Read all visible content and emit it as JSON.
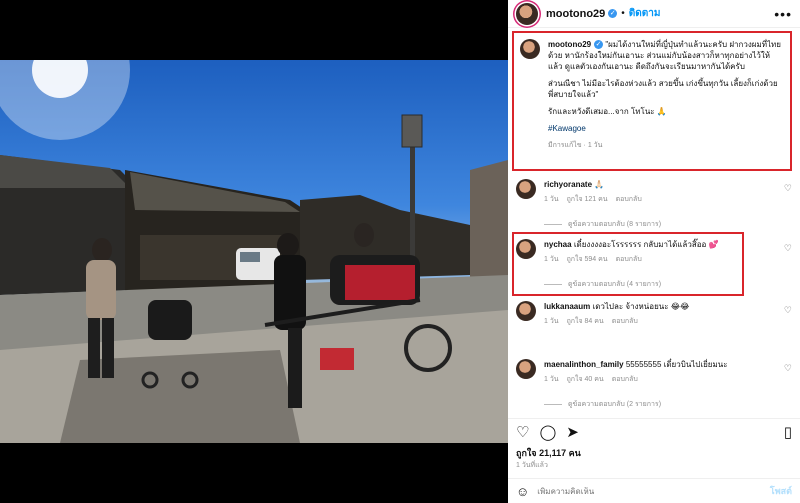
{
  "header": {
    "username": "mootono29",
    "separator": "•",
    "follow_label": "ติดตาม",
    "more_label": "•••"
  },
  "caption": {
    "username": "mootono29",
    "text1": "\"ผมได้งานใหม่ที่ญี่ปุ่นทำแล้วนะครับ ฝากวงผมที่ไทยด้วย หานักร้องใหม่กันเอานะ ส่วนแม่กับน้องสาวก็หาทุกอย่างไว้ให้แล้ว ดูแลตัวเองกันเอานะ ดีดถึงกันจะเรียนมาหากันได้ครับ",
    "text2": "ส่วนณีชา ไม่มีอะไรต้องห่วงแล้ว สวยขึ้น เก่งขึ้นทุกวัน เลี้ยงก็เก่งด้วย พี่สบายใจแล้ว\"",
    "text3": "รักและหวังดีเสมอ...จาก โทโนะ 🙏",
    "hashtag": "#Kawagoe",
    "meta": "มีการแก้ไข · 1 วัน"
  },
  "comments": [
    {
      "user": "richyoranate",
      "text": "🙏🏻",
      "time": "1 วัน",
      "likes": "ถูกใจ 121 คน",
      "reply": "ตอบกลับ",
      "view_replies": "ดูข้อความตอบกลับ (8 รายการ)"
    },
    {
      "user": "nychaa",
      "text": "เดี๋ยงงงงอะโรรรรรร กลับมาได้แล้วสิ๊ออ 💕",
      "time": "1 วัน",
      "likes": "ถูกใจ 594 คน",
      "reply": "ตอบกลับ",
      "view_replies": "ดูข้อความตอบกลับ (4 รายการ)"
    },
    {
      "user": "lukkanaaum",
      "text": "เดวไปละ จ้างหน่อยนะ 😂😂",
      "time": "1 วัน",
      "likes": "ถูกใจ 84 คน",
      "reply": "ตอบกลับ",
      "view_replies": ""
    },
    {
      "user": "maenalinthon_family",
      "text": "55555555 เดี๋ยวบินไปเยี่ยมนะ",
      "time": "1 วัน",
      "likes": "ถูกใจ 40 คน",
      "reply": "ตอบกลับ",
      "view_replies": "ดูข้อความตอบกลับ (2 รายการ)"
    }
  ],
  "actions": {
    "like_icon": "heart-outline-icon",
    "comment_icon": "comment-icon",
    "share_icon": "send-icon",
    "save_icon": "bookmark-icon"
  },
  "likes_label": "ถูกใจ 21,117 คน",
  "posted_ago": "1 วันที่แล้ว",
  "add_comment": {
    "placeholder": "เพิ่มความคิดเห็น",
    "post_label": "โพสต์"
  },
  "colors": {
    "highlight_border": "#d9252b",
    "link_blue": "#0095f6",
    "verified_blue": "#3897f0"
  }
}
